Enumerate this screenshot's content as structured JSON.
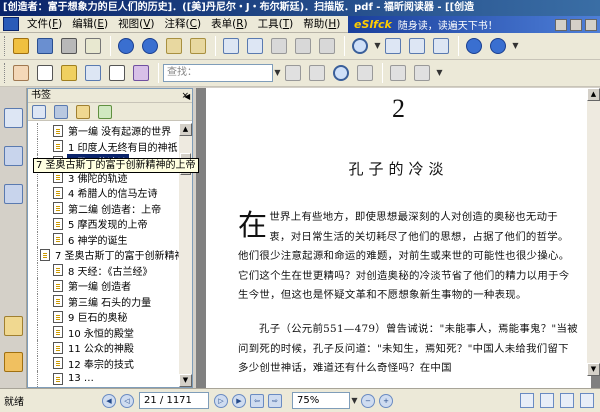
{
  "window": {
    "title": "[创造者：富于想象力的巨人们的历史]．([美]丹尼尔・J・布尔斯廷)．扫描版．pdf - 福昕阅读器 - [[创造"
  },
  "banner": {
    "brand": "eSlfck",
    "slogan": "随身读，读遍天下书！"
  },
  "menu": {
    "items": [
      {
        "label": "文件(",
        "key": "F",
        "tail": ")"
      },
      {
        "label": "编辑(",
        "key": "E",
        "tail": ")"
      },
      {
        "label": "视图(",
        "key": "V",
        "tail": ")"
      },
      {
        "label": "注释(",
        "key": "C",
        "tail": ")"
      },
      {
        "label": "表单(",
        "key": "R",
        "tail": ")"
      },
      {
        "label": "工具(",
        "key": "T",
        "tail": ")"
      },
      {
        "label": "帮助(",
        "key": "H",
        "tail": ")"
      }
    ]
  },
  "toolbar": {
    "search_placeholder": "查找："
  },
  "sidebar": {
    "header": "书签",
    "close": "×",
    "collapse": "◀",
    "items": [
      {
        "label": "第一编 没有起源的世界",
        "selected": false
      },
      {
        "label": "1 印度人无终有目的神祇",
        "selected": false
      },
      {
        "label": "2 孔子的冷淡",
        "selected": true
      },
      {
        "label": "3 佛陀的轨迹",
        "selected": false
      },
      {
        "label": "4 希腊人的信马左诗",
        "selected": false
      },
      {
        "label": "第二编 创造者：上帝",
        "selected": false
      },
      {
        "label": "5 摩西发现的上帝",
        "selected": false
      },
      {
        "label": "6 神学的诞生",
        "selected": false
      },
      {
        "label": "7 圣奥古斯丁的富于创新精神的上帝",
        "selected": false
      },
      {
        "label": "8 天经：《古兰经》",
        "selected": false
      },
      {
        "label": "第一编 创造者",
        "selected": false
      },
      {
        "label": "第三编 石头的力量",
        "selected": false
      },
      {
        "label": "9 巨石的奥秘",
        "selected": false
      },
      {
        "label": "10 永恒的殿堂",
        "selected": false
      },
      {
        "label": "11 公众的神殿",
        "selected": false
      },
      {
        "label": "12 奉宗的技式",
        "selected": false
      },
      {
        "label": "13 …",
        "selected": false
      }
    ],
    "tooltip": "7 圣奥古斯丁的富于创新精神的上帝"
  },
  "page": {
    "chapter_number": "2",
    "chapter_title": "孔子的冷淡",
    "dropcap": "在",
    "paragraph1": "世界上有些地方，即使思想最深刻的人对创造的奥秘也无动于衷，对日常生活的关切耗尽了他们的思想，占据了他们的哲学。他们很少注意起源和命运的难题，对前生或来世的可能性也很少操心。它们这个生在世更精吗？对创造奥秘的冷淡节省了他们的精力以用于今生今世，但这也是怀疑文革和不愿想象新生事物的一种表现。",
    "paragraph2": "孔子（公元前551—479）曾告诫说：\"未能事人，焉能事鬼？\"当被问到死的时候，孔子反问道：\"未知生，焉知死？\"中国人未给我们留下多少创世神话，难道还有什么奇怪吗？在中国"
  },
  "status": {
    "text": "就绪",
    "page_indicator": "21 / 1171",
    "zoom": "75%"
  }
}
